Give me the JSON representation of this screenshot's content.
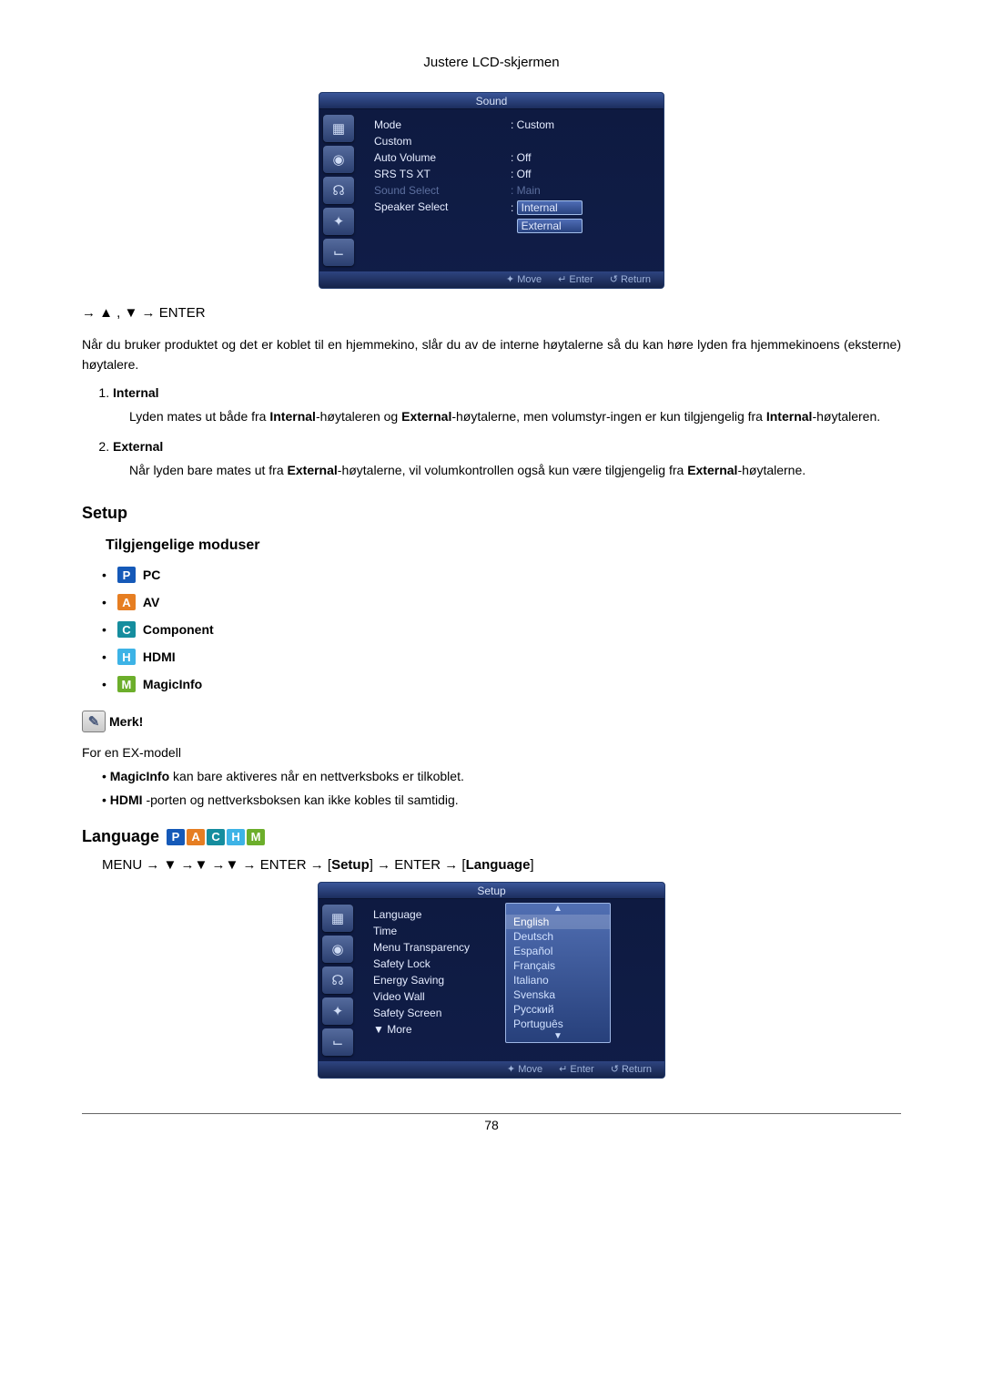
{
  "header": {
    "title": "Justere LCD-skjermen"
  },
  "osd_sound": {
    "title": "Sound",
    "sidebar_icons": [
      "pic-icon",
      "cam-icon",
      "audio-icon",
      "gear-icon",
      "blank-icon"
    ],
    "rows": [
      {
        "label": "Mode",
        "value": "Custom",
        "label_dim": false,
        "value_dim": false
      },
      {
        "label": "Custom",
        "value": "",
        "label_dim": false,
        "value_dim": false
      },
      {
        "label": "Auto Volume",
        "value": "Off",
        "label_dim": false,
        "value_dim": false
      },
      {
        "label": "SRS TS XT",
        "value": "Off",
        "label_dim": false,
        "value_dim": false
      },
      {
        "label": "Sound Select",
        "value": "Main",
        "label_dim": true,
        "value_dim": true
      },
      {
        "label": "Speaker Select",
        "value": "Internal",
        "label_dim": false,
        "value_dim": false,
        "highlighted": true
      },
      {
        "label": "",
        "value": "External",
        "label_dim": false,
        "value_dim": false
      }
    ],
    "footer": {
      "move": "Move",
      "enter": "Enter",
      "return": "Return"
    }
  },
  "nav_line_1": "→ ▲ , ▼ → ENTER",
  "intro_para": "Når du bruker produktet og det er koblet til en hjemmekino, slår du av de interne høytalerne så du kan høre lyden fra hjemmekinoens (eksterne) høytalere.",
  "speaker_options": [
    {
      "title": "Internal",
      "body_parts": [
        "Lyden mates ut både fra ",
        "Internal",
        "-høytaleren og ",
        "External",
        "-høytalerne, men volumstyr-ingen er kun tilgjengelig fra ",
        "Internal",
        "-høytaleren."
      ]
    },
    {
      "title": "External",
      "body_parts": [
        "Når lyden bare mates ut fra ",
        "External",
        "-høytalerne, vil volumkontrollen også kun være tilgjengelig fra ",
        "External",
        "-høytalerne."
      ]
    }
  ],
  "setup_heading": "Setup",
  "modes_heading": "Tilgjengelige moduser",
  "modes": [
    {
      "badge": "P",
      "label": "PC",
      "color_class": "bg-blue"
    },
    {
      "badge": "A",
      "label": "AV",
      "color_class": "bg-orange"
    },
    {
      "badge": "C",
      "label": "Component",
      "color_class": "bg-teal"
    },
    {
      "badge": "H",
      "label": "HDMI",
      "color_class": "bg-sky"
    },
    {
      "badge": "M",
      "label": "MagicInfo",
      "color_class": "bg-green"
    }
  ],
  "merk_label": "Merk!",
  "ex_model_line": "For en EX-modell",
  "notes": [
    {
      "bold": "MagicInfo",
      "rest": " kan bare aktiveres når en nettverksboks er tilkoblet."
    },
    {
      "bold": "HDMI",
      "rest": " -porten og nettverksboksen kan ikke kobles til samtidig."
    }
  ],
  "language_heading": "Language",
  "lang_badges": [
    {
      "txt": "P",
      "cls": "bg-blue"
    },
    {
      "txt": "A",
      "cls": "bg-orange"
    },
    {
      "txt": "C",
      "cls": "bg-teal"
    },
    {
      "txt": "H",
      "cls": "bg-sky"
    },
    {
      "txt": "M",
      "cls": "bg-green"
    }
  ],
  "menu_line": {
    "pre": "MENU → ▼ →▼ →▼ → ENTER → [",
    "setup": "Setup",
    "mid": "] → ENTER → [",
    "lang": "Language",
    "post": "]"
  },
  "osd_setup": {
    "title": "Setup",
    "labels": [
      "Language",
      "Time",
      "Menu Transparency",
      "Safety Lock",
      "Energy Saving",
      "Video Wall",
      "Safety Screen",
      "▼ More"
    ],
    "lang_values": [
      "English",
      "Deutsch",
      "Español",
      "Français",
      "Italiano",
      "Svenska",
      "Русский",
      "Português"
    ],
    "footer": {
      "move": "Move",
      "enter": "Enter",
      "return": "Return"
    }
  },
  "page_number": "78"
}
